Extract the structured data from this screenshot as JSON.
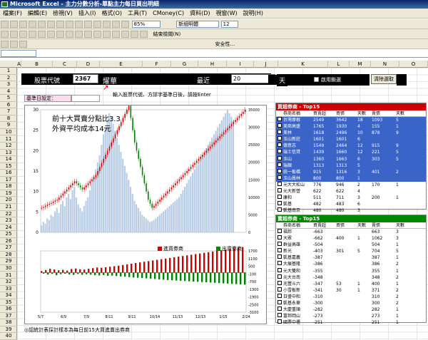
{
  "window": {
    "title": "Microsoft Excel - 主力分數分析-單點主力每日買出明細"
  },
  "menu": [
    "檔案(F)",
    "編輯(E)",
    "檢視(V)",
    "插入(I)",
    "格式(O)",
    "工具(T)",
    "CMoney(C)",
    "資料(D)",
    "視窗(W)",
    "說明(H)"
  ],
  "toolbar": {
    "zoom": "85%",
    "font": "新細明體",
    "font_size": "12",
    "security": "安全性...",
    "review_end": "結束檢閱(N)"
  },
  "columns": [
    "A",
    "B",
    "C",
    "D",
    "E",
    "F",
    "G",
    "H",
    "I",
    "J",
    "K",
    "L",
    "M",
    "N",
    "O"
  ],
  "rows": [
    "1",
    "2",
    "3",
    "4",
    "5",
    "6",
    "7",
    "8",
    "9",
    "10",
    "11",
    "12",
    "13",
    "14",
    "15",
    "16",
    "17",
    "18",
    "19",
    "20",
    "21",
    "22",
    "23",
    "24",
    "25",
    "26",
    "27",
    "28",
    "29",
    "30",
    "31",
    "32",
    "33",
    "34",
    "35",
    "36",
    "37",
    "38",
    "39",
    "40"
  ],
  "header": {
    "stock_label": "股票代號",
    "stock_code": "2367",
    "stock_name": "燿華",
    "recent_label": "最近",
    "recent_days": "20",
    "day_unit": "天",
    "checkbox_label": "啟用鎖選",
    "clear_button": "清除選取"
  },
  "base_date_label": "基準日設定：",
  "instruction": "輸入股票代號、方詳字基準日後，請按Enter",
  "annotation": {
    "line1": "前十大買賣分點比3.3",
    "line2": "外資平均成本14元"
  },
  "legend": {
    "buy": "進貨券商",
    "sell": "出貨券商"
  },
  "footer": "◎認統計表採計樣本為每日前15大買進賣出券商",
  "colors": {
    "price_up": "#cc0000",
    "price_down": "#008000",
    "volume": "#b8cce4",
    "buy_bar": "#cc0000",
    "sell_bar": "#008000",
    "table1_header": "#cc0000",
    "table2_header": "#008000",
    "selected_row": "#3a64c8"
  },
  "table1": {
    "title": "買超券商 - Top15",
    "headers": [
      "券商名稱",
      "買賣超",
      "買張",
      "天數",
      "賣張",
      "天數"
    ],
    "rows": [
      [
        "台灣摩根",
        "2549",
        "3642",
        "18",
        "1093",
        "5"
      ],
      [
        "美商高盛",
        "1765",
        "1930",
        "4",
        "155",
        "1"
      ],
      [
        "美林",
        "1618",
        "2496",
        "10",
        "878",
        "9"
      ],
      [
        "玉山新莊",
        "1601",
        "1601",
        "6",
        "",
        ""
      ],
      [
        "德意志",
        "1549",
        "2464",
        "12",
        "915",
        "9"
      ],
      [
        "瑞士信貸",
        "1439",
        "1660",
        "12",
        "221",
        "5"
      ],
      [
        "玉山",
        "1360",
        "1663",
        "6",
        "303",
        "5"
      ],
      [
        "瑞銀",
        "1313",
        "1313",
        "5",
        "",
        ""
      ],
      [
        "統一板橋",
        "915",
        "1316",
        "3",
        "401",
        "2"
      ],
      [
        "玉山員林",
        "800",
        "800",
        "1",
        "",
        ""
      ],
      [
        "元大大松山",
        "776",
        "946",
        "2",
        "170",
        "1"
      ],
      [
        "元大新營",
        "622",
        "622",
        "4",
        "",
        ""
      ],
      [
        "康和",
        "511",
        "711",
        "3",
        "200",
        "1"
      ],
      [
        "凱基",
        "482",
        "483",
        "6",
        "",
        ""
      ],
      [
        "凱基南京",
        "480",
        "480",
        "3",
        "",
        ""
      ]
    ],
    "selected": [
      0,
      1,
      2,
      3,
      4,
      5,
      6,
      7,
      8,
      9
    ]
  },
  "table2": {
    "title": "賣超券商 - Top15",
    "headers": [
      "券商名稱",
      "買賣超",
      "買張",
      "天數",
      "賣張",
      "天數"
    ],
    "rows": [
      [
        "福邦",
        "-663",
        "",
        "",
        "663",
        "3"
      ],
      [
        "大眾",
        "-662",
        "400",
        "1",
        "1062",
        "3"
      ],
      [
        "群益高雄",
        "-504",
        "",
        "",
        "504",
        "1"
      ],
      [
        "新光",
        "-403",
        "301",
        "5",
        "704",
        "5"
      ],
      [
        "凱基嘉義",
        "-387",
        "",
        "",
        "387",
        "1"
      ],
      [
        "大展基隆",
        "-386",
        "",
        "",
        "386",
        "2"
      ],
      [
        "元大雙和",
        "-355",
        "",
        "",
        "355",
        "1"
      ],
      [
        "元大台南",
        "-348",
        "",
        "",
        "348",
        "2"
      ],
      [
        "兆豐斗六",
        "-347",
        "53",
        "1",
        "400",
        "1"
      ],
      [
        "小雪板新",
        "-341",
        "30",
        "1",
        "371",
        "2"
      ],
      [
        "日盛中和",
        "-310",
        "",
        "",
        "310",
        "2"
      ],
      [
        "凱基永華",
        "-300",
        "",
        "",
        "300",
        "2"
      ],
      [
        "大慶重順",
        "-282",
        "",
        "",
        "282",
        "1"
      ],
      [
        "富邦岡山",
        "-273",
        "",
        "",
        "273",
        "1"
      ],
      [
        "國票中壢",
        "-251",
        "",
        "",
        "251",
        "1"
      ]
    ]
  },
  "chart_data": [
    {
      "type": "line",
      "title": "",
      "description": "candlestick price with volume",
      "price_axis": [
        0,
        5,
        10,
        15,
        20,
        25,
        30
      ],
      "volume_axis": [
        0,
        5000,
        10000,
        15000,
        20000,
        25000,
        30000,
        35000
      ],
      "ylim_price": [
        0,
        30
      ],
      "ylim_volume": [
        0,
        35000
      ],
      "x_ticks": [
        "5/7",
        "6/9",
        "7/9",
        "8/11",
        "9/11",
        "10/14",
        "11/13",
        "12/13",
        "1/15",
        "2/24"
      ],
      "close": [
        6,
        6.2,
        6.5,
        6.8,
        7,
        7.2,
        7.5,
        7.8,
        8,
        8.5,
        9,
        9.5,
        10,
        10.5,
        11,
        11.5,
        12,
        12.5,
        12,
        11.5,
        11,
        10.5,
        11,
        11.5,
        12,
        12.5,
        13,
        13.5,
        14,
        15,
        16,
        17,
        18,
        19,
        20,
        21,
        22,
        23,
        24,
        25,
        26,
        27,
        28,
        29,
        30,
        31,
        28,
        25,
        22,
        20,
        18,
        16,
        14,
        12,
        10,
        8,
        7,
        6,
        6.5,
        7,
        7.5,
        8,
        8.5,
        9,
        9.5,
        10,
        10.5,
        11,
        11.5,
        12,
        12.5,
        13,
        13.5,
        14,
        14.5,
        15,
        15.5,
        16,
        16.5,
        17,
        17.5,
        18,
        18.5,
        19,
        19.5,
        20,
        20.5,
        21,
        21.5,
        22,
        22.5,
        23,
        23.5,
        24,
        24.5,
        25,
        25.5,
        26,
        26.5,
        27,
        27.5,
        28,
        28.5,
        29,
        29.5,
        30
      ],
      "volume": [
        2000,
        3000,
        2500,
        4000,
        3500,
        5000,
        4500,
        6000,
        7000,
        5500,
        8000,
        9000,
        7500,
        10000,
        11000,
        9500,
        12000,
        13000,
        10000,
        8000,
        7000,
        6000,
        7500,
        9000,
        10000,
        12000,
        14000,
        16000,
        18000,
        20000,
        22000,
        25000,
        28000,
        30000,
        32000,
        34000,
        33000,
        31000,
        29000,
        27000,
        25000,
        23000,
        21000,
        19000,
        17000,
        15000,
        13000,
        11000,
        9000,
        8000,
        7000,
        6000,
        5000,
        4500,
        4000,
        3500,
        3000,
        3200,
        3500,
        4000,
        4500,
        5000,
        5500,
        6000,
        6500,
        7000,
        7500,
        8000,
        8500,
        9000,
        9500,
        10000,
        11000,
        12000,
        13000,
        14000,
        15000,
        16000,
        17000,
        18000,
        19000,
        20000,
        21000,
        22000,
        23000,
        24000,
        25000,
        26000,
        27000,
        28000,
        29000,
        30000,
        31000,
        32000,
        33000,
        34000,
        35000,
        34000,
        33000,
        32000
      ]
    },
    {
      "type": "bar",
      "title": "",
      "series": [
        {
          "name": "進貨券商",
          "values": [
            120,
            -80,
            200,
            -150,
            300,
            -100,
            250,
            -200,
            180,
            -120,
            220,
            -90,
            160,
            -140,
            280,
            -180,
            320,
            -110,
            260,
            -170,
            240,
            -130,
            300,
            -160,
            350,
            -200,
            400,
            -220,
            380,
            -190,
            420,
            -250,
            460,
            -230,
            500,
            -270,
            540,
            -300,
            600,
            -320,
            650,
            -350,
            700,
            -380,
            750,
            -400,
            800,
            -420,
            850,
            -450,
            900,
            -470,
            950,
            -500,
            1000,
            -530,
            1050,
            -560,
            1100,
            -580,
            1150,
            -600,
            1200,
            -620,
            1250,
            -640,
            1300,
            -660,
            1350,
            -680,
            1400,
            -700,
            1450,
            -720,
            1500,
            -740,
            1550,
            -760,
            1600,
            -780,
            1650,
            -800,
            1700,
            -820,
            1750,
            -840,
            1800,
            -860,
            1850,
            -880,
            1900,
            -900,
            1950,
            -920,
            2000,
            -940
          ]
        }
      ],
      "y_ticks": [
        "1700",
        "1100",
        "500",
        "-100",
        "-700",
        "-1300",
        "-1900",
        "-2500",
        "-3100"
      ],
      "x_ticks": [
        "5/7",
        "6/9",
        "7/9",
        "8/11",
        "9/11",
        "10/14",
        "11/13",
        "12/13",
        "1/15",
        "2/24"
      ]
    }
  ]
}
